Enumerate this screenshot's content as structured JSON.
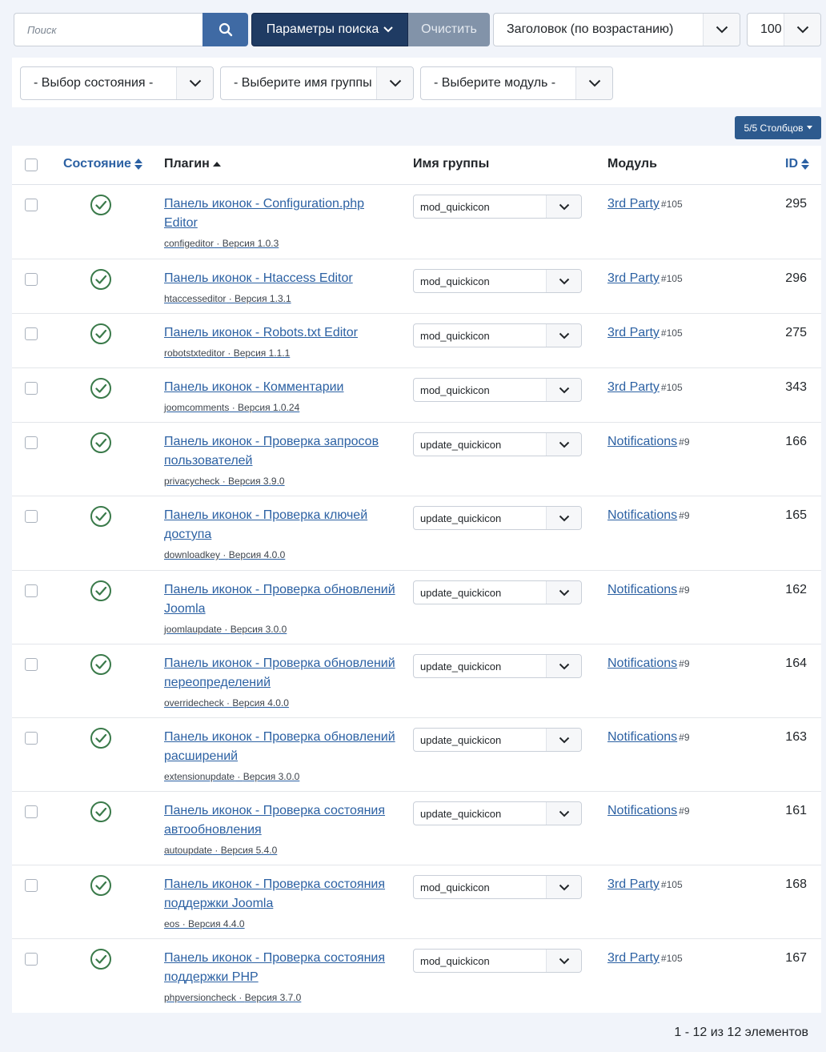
{
  "toolbar": {
    "search_placeholder": "Поиск",
    "search_options_label": "Параметры поиска",
    "clear_label": "Очистить",
    "sort_value": "Заголовок (по возрастанию)",
    "limit_value": "100"
  },
  "filters": {
    "state": "- Выбор состояния -",
    "group": "- Выберите имя группы",
    "module": "- Выберите модуль -"
  },
  "columns_button": "5/5 Столбцов",
  "table": {
    "headers": {
      "state": "Состояние",
      "plugin": "Плагин",
      "group": "Имя группы",
      "module": "Модуль",
      "id": "ID"
    },
    "rows": [
      {
        "title": "Панель иконок - Configuration.php Editor",
        "element": "configeditor",
        "version": "Версия 1.0.3",
        "group": "mod_quickicon",
        "module": "3rd Party",
        "module_id": "#105",
        "id": "295"
      },
      {
        "title": "Панель иконок - Htaccess Editor",
        "element": "htaccesseditor",
        "version": "Версия 1.3.1",
        "group": "mod_quickicon",
        "module": "3rd Party",
        "module_id": "#105",
        "id": "296"
      },
      {
        "title": "Панель иконок - Robots.txt Editor",
        "element": "robotstxteditor",
        "version": "Версия 1.1.1",
        "group": "mod_quickicon",
        "module": "3rd Party",
        "module_id": "#105",
        "id": "275"
      },
      {
        "title": "Панель иконок - Комментарии",
        "element": "joomcomments",
        "version": "Версия 1.0.24",
        "group": "mod_quickicon",
        "module": "3rd Party",
        "module_id": "#105",
        "id": "343"
      },
      {
        "title": "Панель иконок - Проверка запросов пользователей",
        "element": "privacycheck",
        "version": "Версия 3.9.0",
        "group": "update_quickicon",
        "module": "Notifications",
        "module_id": "#9",
        "id": "166"
      },
      {
        "title": "Панель иконок - Проверка ключей доступа",
        "element": "downloadkey",
        "version": "Версия 4.0.0",
        "group": "update_quickicon",
        "module": "Notifications",
        "module_id": "#9",
        "id": "165"
      },
      {
        "title": "Панель иконок - Проверка обновлений Joomla",
        "element": "joomlaupdate",
        "version": "Версия 3.0.0",
        "group": "update_quickicon",
        "module": "Notifications",
        "module_id": "#9",
        "id": "162"
      },
      {
        "title": "Панель иконок - Проверка обновлений переопределений",
        "element": "overridecheck",
        "version": "Версия 4.0.0",
        "group": "update_quickicon",
        "module": "Notifications",
        "module_id": "#9",
        "id": "164"
      },
      {
        "title": "Панель иконок - Проверка обновлений расширений",
        "element": "extensionupdate",
        "version": "Версия 3.0.0",
        "group": "update_quickicon",
        "module": "Notifications",
        "module_id": "#9",
        "id": "163"
      },
      {
        "title": "Панель иконок - Проверка состояния автообновления",
        "element": "autoupdate",
        "version": "Версия 5.4.0",
        "group": "update_quickicon",
        "module": "Notifications",
        "module_id": "#9",
        "id": "161"
      },
      {
        "title": "Панель иконок - Проверка состояния поддержки Joomla",
        "element": "eos",
        "version": "Версия 4.4.0",
        "group": "mod_quickicon",
        "module": "3rd Party",
        "module_id": "#105",
        "id": "168"
      },
      {
        "title": "Панель иконок - Проверка состояния поддержки PHP",
        "element": "phpversioncheck",
        "version": "Версия 3.7.0",
        "group": "mod_quickicon",
        "module": "3rd Party",
        "module_id": "#105",
        "id": "167"
      }
    ]
  },
  "pagination_info": "1 - 12 из 12 элементов"
}
